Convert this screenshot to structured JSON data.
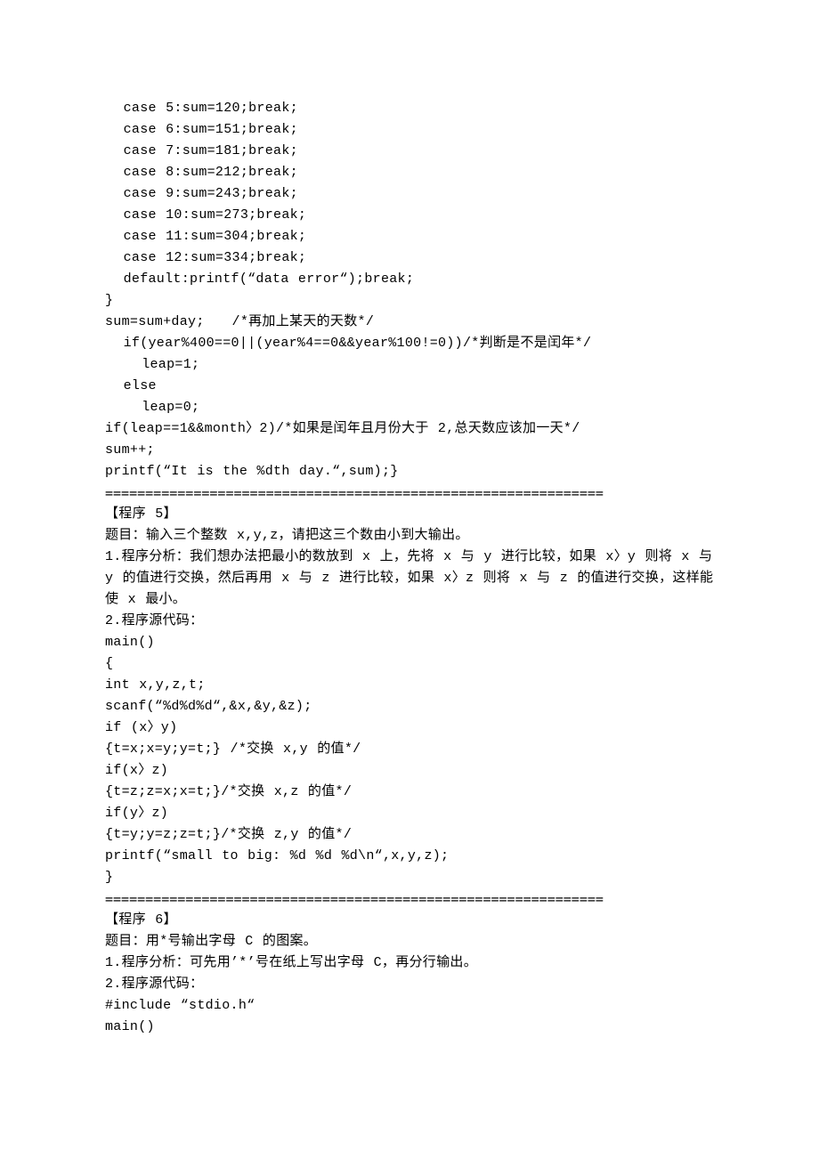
{
  "block1": {
    "lines": [
      "  case 5:sum=120;break;",
      "  case 6:sum=151;break;",
      "  case 7:sum=181;break;",
      "  case 8:sum=212;break;",
      "  case 9:sum=243;break;",
      "  case 10:sum=273;break;",
      "  case 11:sum=304;break;",
      "  case 12:sum=334;break;",
      "  default:printf(“data error“);break;",
      "}",
      "sum=sum+day;   /*再加上某天的天数*/",
      "  if(year%400==0||(year%4==0&&year%100!=0))/*判断是不是闰年*/",
      "    leap=1;",
      "  else",
      "    leap=0;",
      "if(leap==1&&month〉2)/*如果是闰年且月份大于 2,总天数应该加一天*/",
      "sum++;",
      "printf(“It is the %dth day.“,sum);}"
    ],
    "sep": "=============================================================="
  },
  "block2": {
    "title": "【程序 5】",
    "problem": "题目：输入三个整数 x,y,z，请把这三个数由小到大输出。",
    "analysis1": "1.程序分析：我们想办法把最小的数放到 x 上，先将 x 与 y 进行比较，如果 x〉y 则将 x 与",
    "analysis2": "y 的值进行交换，然后再用 x 与 z 进行比较，如果 x〉z 则将 x 与 z 的值进行交换，这样能",
    "analysis3": "使 x 最小。",
    "src_label": "2.程序源代码：",
    "lines": [
      "main()",
      "{",
      "int x,y,z,t;",
      "scanf(“%d%d%d“,&x,&y,&z);",
      "if (x〉y)",
      "{t=x;x=y;y=t;} /*交换 x,y 的值*/",
      "if(x〉z)",
      "{t=z;z=x;x=t;}/*交换 x,z 的值*/",
      "if(y〉z)",
      "{t=y;y=z;z=t;}/*交换 z,y 的值*/",
      "printf(“small to big: %d %d %d\\n“,x,y,z);",
      "}"
    ],
    "sep": "=============================================================="
  },
  "block3": {
    "title": "【程序 6】",
    "problem": "题目：用*号输出字母 C 的图案。",
    "analysis": "1.程序分析：可先用’*’号在纸上写出字母 C，再分行输出。",
    "src_label": "2.程序源代码：",
    "lines": [
      "#include “stdio.h“",
      "main()"
    ]
  }
}
